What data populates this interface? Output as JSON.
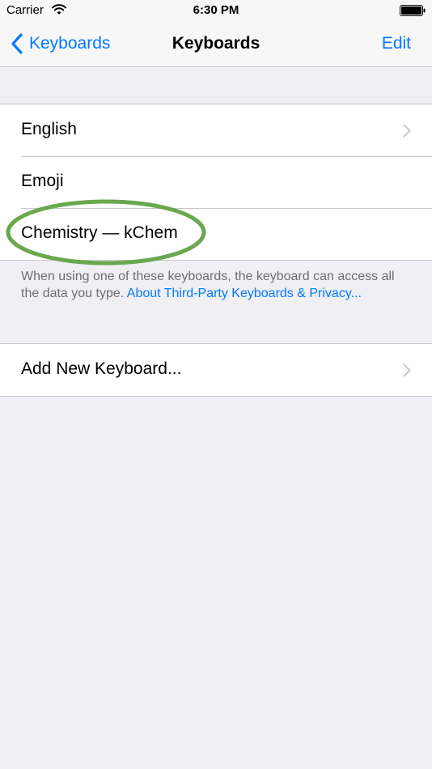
{
  "status_bar": {
    "carrier": "Carrier",
    "time": "6:30 PM",
    "wifi_icon": "wifi-icon",
    "battery_icon": "battery-icon"
  },
  "nav": {
    "back_label": "Keyboards",
    "title": "Keyboards",
    "edit_label": "Edit",
    "accent_color": "#007aff"
  },
  "keyboards": [
    {
      "label": "English",
      "has_chevron": true
    },
    {
      "label": "Emoji",
      "has_chevron": false
    },
    {
      "label": "Chemistry — kChem",
      "has_chevron": false,
      "highlighted": true
    }
  ],
  "footer": {
    "text": "When using one of these keyboards, the keyboard can access all the data you type. ",
    "link": "About Third-Party Keyboards & Privacy..."
  },
  "add_keyboard": {
    "label": "Add New Keyboard..."
  },
  "colors": {
    "background": "#efeff4",
    "highlight": "#6aa84f",
    "separator": "#c8c7cc"
  }
}
